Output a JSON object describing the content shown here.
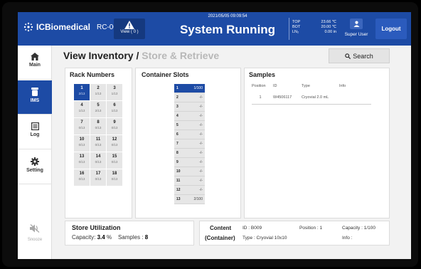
{
  "header": {
    "brand": "ICBiomedical",
    "device": "RC-001",
    "view_button": "View ( 0 )",
    "datetime": "2021/05/05 09:09:54",
    "status": "System Running",
    "temps": [
      {
        "label": "TOP",
        "value": "23.66",
        "unit": "℃"
      },
      {
        "label": "BOT",
        "value": "20.00",
        "unit": "℃"
      },
      {
        "label": "LN₂",
        "value": "0.00",
        "unit": "in"
      }
    ],
    "user": "Super User",
    "logout": "Logout"
  },
  "sidebar": {
    "items": [
      {
        "label": "Main",
        "icon": "home-icon"
      },
      {
        "label": "IMS",
        "icon": "tube-icon",
        "active": true
      },
      {
        "label": "Log",
        "icon": "log-icon"
      },
      {
        "label": "Setting",
        "icon": "gear-icon"
      }
    ],
    "snooze": "Snooze"
  },
  "page": {
    "title": "View Inventory",
    "separator": "/",
    "subtitle": "Store & Retrieve",
    "search": "Search"
  },
  "rack": {
    "title": "Rack Numbers",
    "items": [
      {
        "num": "1",
        "count": "2/13",
        "active": true
      },
      {
        "num": "2",
        "count": "1/13"
      },
      {
        "num": "3",
        "count": "1/13"
      },
      {
        "num": "4",
        "count": "1/13"
      },
      {
        "num": "5",
        "count": "2/13"
      },
      {
        "num": "6",
        "count": "1/13"
      },
      {
        "num": "7",
        "count": "0/13"
      },
      {
        "num": "8",
        "count": "0/13"
      },
      {
        "num": "9",
        "count": "0/13"
      },
      {
        "num": "10",
        "count": "0/13"
      },
      {
        "num": "11",
        "count": "0/13"
      },
      {
        "num": "12",
        "count": "0/13"
      },
      {
        "num": "13",
        "count": "0/13"
      },
      {
        "num": "14",
        "count": "0/13"
      },
      {
        "num": "15",
        "count": "0/13"
      },
      {
        "num": "16",
        "count": "0/13"
      },
      {
        "num": "17",
        "count": "0/13"
      },
      {
        "num": "18",
        "count": "0/13"
      }
    ]
  },
  "slots": {
    "title": "Container Slots",
    "items": [
      {
        "num": "1",
        "value": "1/100",
        "active": true
      },
      {
        "num": "2",
        "value": "-/-"
      },
      {
        "num": "3",
        "value": "-/-"
      },
      {
        "num": "4",
        "value": "-/-"
      },
      {
        "num": "5",
        "value": "-/-"
      },
      {
        "num": "6",
        "value": "-/-"
      },
      {
        "num": "7",
        "value": "-/-"
      },
      {
        "num": "8",
        "value": "-/-"
      },
      {
        "num": "9",
        "value": "-/-"
      },
      {
        "num": "10",
        "value": "-/-"
      },
      {
        "num": "11",
        "value": "-/-"
      },
      {
        "num": "12",
        "value": "-/-"
      },
      {
        "num": "13",
        "value": "2/100"
      }
    ]
  },
  "samples": {
    "title": "Samples",
    "columns": [
      "Position",
      "ID",
      "Type",
      "Info"
    ],
    "rows": [
      {
        "position": "1",
        "id": "W4506117",
        "type": "Cryovial 2.0 mL",
        "info": ""
      }
    ]
  },
  "utilization": {
    "title": "Store Utilization",
    "capacity_label": "Capacity:",
    "capacity_value": "3.4",
    "capacity_unit": "%",
    "samples_label": "Samples :",
    "samples_value": "8"
  },
  "content": {
    "label": "Content",
    "sub_label": "(Container)",
    "id": "ID : B009",
    "position": "Position : 1",
    "capacity": "Capacity : 1/100",
    "type": "Type : Cryovial 10x10",
    "info": "Info :"
  },
  "colors": {
    "primary": "#1d4ba5",
    "header_button": "#15397f"
  }
}
